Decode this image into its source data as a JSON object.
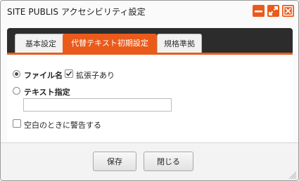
{
  "window": {
    "title": "SITE PUBLIS アクセシビリティ設定",
    "accent_color": "#ea5b1b",
    "controls": [
      "minimize-icon",
      "maximize-icon",
      "close-icon"
    ]
  },
  "tabs": [
    {
      "label": "基本設定",
      "active": false
    },
    {
      "label": "代替テキスト初期設定",
      "active": true
    },
    {
      "label": "規格準拠",
      "active": false
    }
  ],
  "form": {
    "filename_radio": {
      "label": "ファイル名",
      "checked": true
    },
    "extension_checkbox": {
      "label": "拡張子あり",
      "checked": true
    },
    "text_radio": {
      "label": "テキスト指定",
      "checked": false
    },
    "text_input": {
      "value": "",
      "placeholder": ""
    },
    "warn_checkbox": {
      "label": "空白のときに警告する",
      "checked": false
    }
  },
  "footer": {
    "save_label": "保存",
    "close_label": "閉じる"
  }
}
